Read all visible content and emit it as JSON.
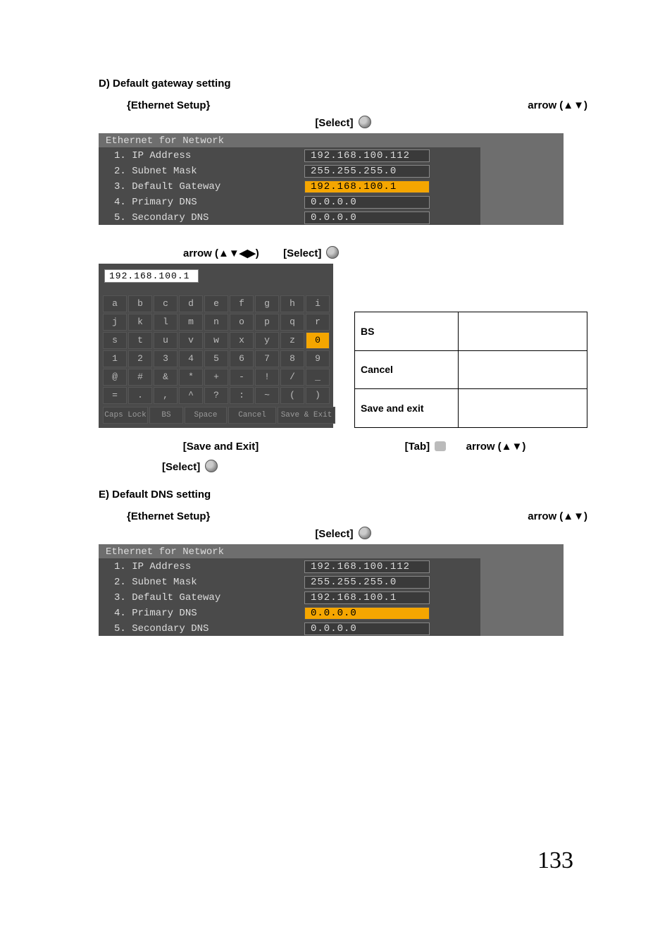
{
  "sectionD": {
    "heading": "D) Default gateway setting",
    "ethernet_setup": "{Ethernet Setup}",
    "arrow_ud": "arrow (▲▼)",
    "select": "[Select]"
  },
  "ethTable1": {
    "title": "Ethernet for Network",
    "rows": [
      {
        "label": "1. IP Address",
        "value": "192.168.100.112",
        "hl": false
      },
      {
        "label": "2. Subnet Mask",
        "value": "255.255.255.0",
        "hl": false
      },
      {
        "label": "3. Default Gateway",
        "value": "192.168.100.1",
        "hl": true
      },
      {
        "label": "4. Primary DNS",
        "value": "0.0.0.0",
        "hl": false
      },
      {
        "label": "5. Secondary DNS",
        "value": "0.0.0.0",
        "hl": false
      }
    ]
  },
  "kbdLine": {
    "arrow_all": "arrow (▲▼◀▶)",
    "select": "[Select]"
  },
  "kbd": {
    "input": "192.168.100.1",
    "rows": [
      [
        "a",
        "b",
        "c",
        "d",
        "e",
        "f",
        "g",
        "h",
        "i"
      ],
      [
        "j",
        "k",
        "l",
        "m",
        "n",
        "o",
        "p",
        "q",
        "r"
      ],
      [
        "s",
        "t",
        "u",
        "v",
        "w",
        "x",
        "y",
        "z",
        "0"
      ],
      [
        "1",
        "2",
        "3",
        "4",
        "5",
        "6",
        "7",
        "8",
        "9"
      ],
      [
        "@",
        "#",
        "&",
        "*",
        "+",
        "-",
        "!",
        "/",
        "_"
      ],
      [
        "=",
        ".",
        ",",
        "^",
        "?",
        ":",
        "~",
        "(",
        ")"
      ]
    ],
    "hl_row": 2,
    "hl_col": 8,
    "bottom": [
      "Caps Lock",
      "BS",
      "Space",
      "Cancel",
      "Save & Exit"
    ]
  },
  "funcTable": {
    "rows": [
      "BS",
      "Cancel",
      "Save and exit"
    ]
  },
  "postKbd": {
    "save_exit": "[Save and Exit]",
    "tab": "[Tab]",
    "arrow_ud": "arrow (▲▼)",
    "select": "[Select]"
  },
  "sectionE": {
    "heading": "E) Default DNS setting",
    "ethernet_setup": "{Ethernet Setup}",
    "arrow_ud": "arrow (▲▼)",
    "select": "[Select]"
  },
  "ethTable2": {
    "title": "Ethernet for Network",
    "rows": [
      {
        "label": "1. IP Address",
        "value": "192.168.100.112",
        "hl": false
      },
      {
        "label": "2. Subnet Mask",
        "value": "255.255.255.0",
        "hl": false
      },
      {
        "label": "3. Default Gateway",
        "value": "192.168.100.1",
        "hl": false
      },
      {
        "label": "4. Primary DNS",
        "value": "0.0.0.0",
        "hl": true
      },
      {
        "label": "5. Secondary DNS",
        "value": "0.0.0.0",
        "hl": false
      }
    ]
  },
  "pageNumber": "133"
}
